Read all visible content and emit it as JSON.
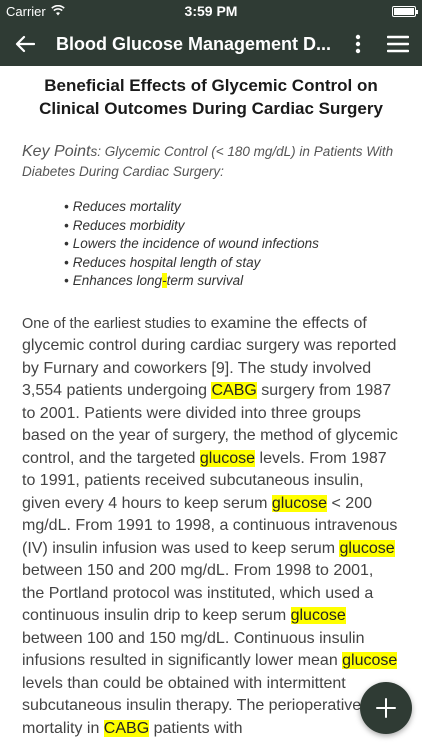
{
  "status": {
    "carrier": "Carrier",
    "time": "3:59 PM"
  },
  "nav": {
    "title": "Blood Glucose Management D..."
  },
  "article": {
    "title": "Beneficial Effects of Glycemic Control on Clinical Outcomes During Cardiac Surgery",
    "key_label": "Key Point",
    "key_text": "s: Glycemic Control (< 180 mg/dL) in Patients With Diabetes During Cardiac Surgery:",
    "bullets": [
      "Reduces mortality",
      "Reduces morbidity",
      "Lowers the incidence of wound infections",
      "Reduces hospital length of stay"
    ],
    "bullet5_pre": "Enhances long",
    "bullet5_hl": "-",
    "bullet5_post": "term survival",
    "body": {
      "lead": "One of the earliest studies to ",
      "t1": "examine the effects of glycemic control during cardiac surgery was reported by Furnary and coworkers [9]. The study involved 3,554 patients undergoing ",
      "cabg1": "CABG",
      "t2": " surgery from 1987 to 2001. Patients were divided into three groups based on the year of surgery, the method of glycemic control, and the targeted ",
      "glucose1": "glucose",
      "t3": " levels. From 1987 to 1991, patients received subcutaneous insulin, given every 4 hours to keep serum ",
      "glucose2": "glucose",
      "t4": " < 200 mg/dL. From 1991 to 1998, a continuous intravenous (IV) insulin infusion was used to keep serum ",
      "glucose3": "glucose",
      "t5": " between 150 and 200 mg/dL. From 1998 to 2001, the Portland protocol was instituted, which used a continuous insulin drip to keep serum ",
      "glucose4": "glucose",
      "t6": " between 100 and 150 mg/dL. Continuous insulin infusions resulted in significantly lower mean ",
      "glucose5": "glucose",
      "t7": " levels than could be obtained with intermittent subcutaneous insulin therapy. The perioperative mortality in ",
      "cabg2": "CABG",
      "t8": " patients with"
    }
  },
  "colors": {
    "header": "#2f3b34",
    "highlight": "#ffff00"
  },
  "icons": {
    "back": "arrow-left-icon",
    "more": "more-vertical-icon",
    "menu": "hamburger-menu-icon",
    "fab": "plus-icon",
    "wifi": "wifi-icon",
    "battery": "battery-icon"
  }
}
